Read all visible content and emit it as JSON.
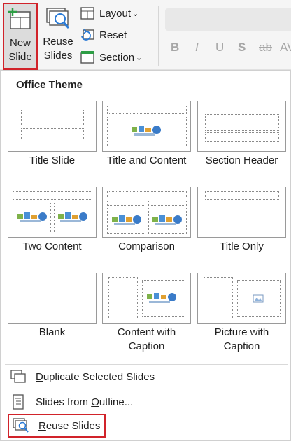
{
  "ribbon": {
    "new_slide_line1": "New",
    "new_slide_line2": "Slide",
    "new_slide_chevron": "⌄",
    "reuse_line1": "Reuse",
    "reuse_line2": "Slides",
    "layout": "Layout",
    "reset": "Reset",
    "section": "Section",
    "chevron": "⌄",
    "format": {
      "bold": "B",
      "italic": "I",
      "underline": "U",
      "shadow": "S",
      "strike": "ab",
      "spacing": "AV"
    }
  },
  "panel": {
    "title": "Office Theme",
    "layouts": [
      {
        "name": "Title Slide"
      },
      {
        "name": "Title and Content"
      },
      {
        "name": "Section Header"
      },
      {
        "name": "Two Content"
      },
      {
        "name": "Comparison"
      },
      {
        "name": "Title Only"
      },
      {
        "name": "Blank"
      },
      {
        "name": "Content with",
        "name2": "Caption"
      },
      {
        "name": "Picture with",
        "name2": "Caption"
      }
    ],
    "menu": {
      "duplicate": {
        "first": "D",
        "rest": "uplicate Selected Slides"
      },
      "outline": {
        "before": "Slides from ",
        "underlined": "O",
        "after": "utline..."
      },
      "reuse": {
        "first": "R",
        "rest": "euse Slides"
      }
    }
  },
  "colors": {
    "highlight_border": "#d1232a",
    "ribbon_bg": "#f5f5f5",
    "accent_green": "#2e9e45",
    "icon_blue": "#2b7bd6"
  }
}
